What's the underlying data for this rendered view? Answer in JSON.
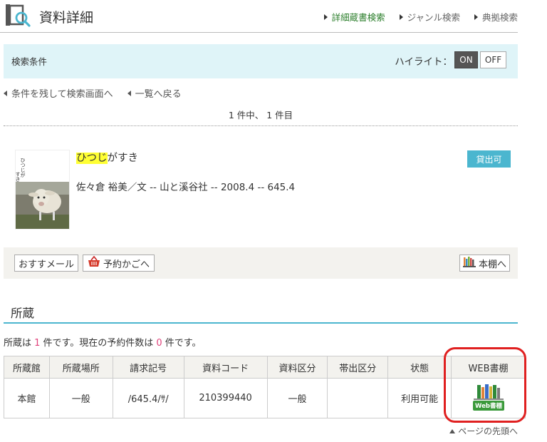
{
  "header": {
    "title": "資料詳細",
    "nav": [
      "詳細蔵書検索",
      "ジャンル検索",
      "典拠検索"
    ]
  },
  "search_condition": {
    "label": "検索条件",
    "highlight_label": "ハイライト：",
    "on": "ON",
    "off": "OFF"
  },
  "back_links": [
    "条件を残して検索画面へ",
    "一覧へ戻る"
  ],
  "count_text": "1 件中、 1 件目",
  "record": {
    "title_highlight": "ひつじ",
    "title_rest": "がすき",
    "cover_text": "ひつじがすき",
    "meta": "佐々倉 裕美／文 -- 山と溪谷社 -- 2008.4 -- 645.4",
    "status": "貸出可"
  },
  "actions": {
    "mail": "おすすメール",
    "cart": "予約かごへ",
    "shelf": "本棚へ"
  },
  "holdings": {
    "section_title": "所蔵",
    "summary_prefix": "所蔵は ",
    "holdings_count": "1",
    "summary_mid": " 件です。現在の予約件数は ",
    "reservation_count": "0",
    "summary_suffix": " 件です。",
    "columns": [
      "所蔵館",
      "所蔵場所",
      "請求記号",
      "資料コード",
      "資料区分",
      "帯出区分",
      "状態",
      "WEB書棚"
    ],
    "row": {
      "library": "本館",
      "location": "一般",
      "call_number": "/645.4/ｻ/",
      "code": "210399440",
      "category": "一般",
      "loan_class": "",
      "state": "利用可能",
      "web_shelf_icon_label": "Web書棚"
    }
  },
  "page_top": "ページの先頭へ",
  "colors": {
    "accent": "#4bb6cf",
    "highlight": "#ffff33",
    "ring": "#e02020"
  }
}
